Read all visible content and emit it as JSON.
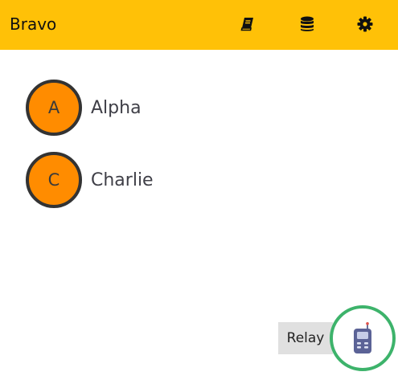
{
  "header": {
    "title": "Bravo",
    "icons": [
      "book-icon",
      "database-icon",
      "gear-icon"
    ],
    "background_color": "#ffc107"
  },
  "contacts": [
    {
      "initial": "A",
      "name": "Alpha"
    },
    {
      "initial": "C",
      "name": "Charlie"
    }
  ],
  "avatar_color": "#ff8c00",
  "relay": {
    "label": "Relay",
    "icon": "walkie-talkie-icon",
    "ring_color": "#3db36b"
  }
}
